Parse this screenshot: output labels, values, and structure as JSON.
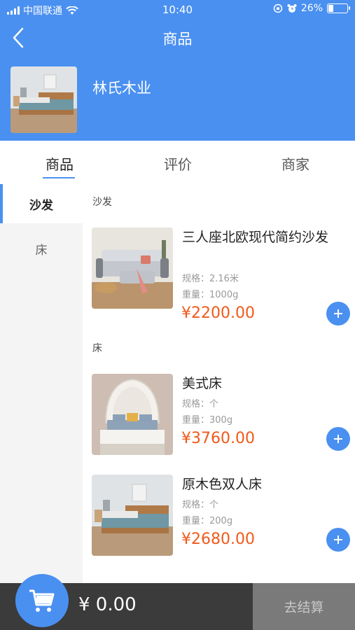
{
  "status_bar": {
    "carrier": "中国联通",
    "time": "10:40",
    "battery": "26%",
    "battery_level": 0.26
  },
  "nav": {
    "title": "商品",
    "back_icon": "chevron-left-icon"
  },
  "store": {
    "name": "林氏木业"
  },
  "tabs": [
    {
      "label": "商品",
      "active": true
    },
    {
      "label": "评价",
      "active": false
    },
    {
      "label": "商家",
      "active": false
    }
  ],
  "categories": [
    {
      "label": "沙发",
      "active": true
    },
    {
      "label": "床",
      "active": false
    }
  ],
  "groups": [
    {
      "label": "沙发",
      "products": [
        {
          "name": "三人座北欧现代简约沙发",
          "spec": "规格：2.16米",
          "weight": "重量：1000g",
          "price": "¥2200.00"
        }
      ]
    },
    {
      "label": "床",
      "products": [
        {
          "name": "美式床",
          "spec": "规格：个",
          "weight": "重量：300g",
          "price": "¥3760.00"
        },
        {
          "name": "原木色双人床",
          "spec": "规格：个",
          "weight": "重量：200g",
          "price": "¥2680.00"
        }
      ]
    }
  ],
  "cart": {
    "total": "¥ 0.00",
    "checkout_label": "去结算",
    "icon": "cart-icon"
  },
  "colors": {
    "accent": "#4a90f0",
    "price": "#f05a1a",
    "cart_bar": "#3b3b3b",
    "checkout_bg": "#7a7a7a"
  }
}
